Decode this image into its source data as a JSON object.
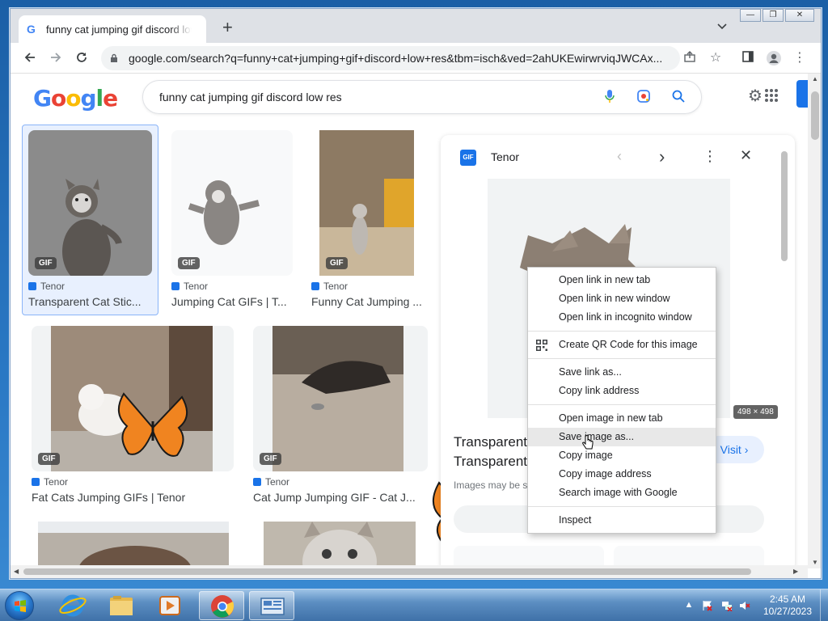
{
  "browser": {
    "tab_title": "funny cat jumping gif discord low res",
    "tab_close": "×",
    "new_tab": "+",
    "url": "google.com/search?q=funny+cat+jumping+gif+discord+low+res&tbm=isch&ved=2ahUKEwirwrviqJWCAx..."
  },
  "google": {
    "logo": [
      "G",
      "o",
      "o",
      "g",
      "l",
      "e"
    ],
    "logo_colors": [
      "#4285f4",
      "#ea4335",
      "#fbbc05",
      "#4285f4",
      "#34a853",
      "#ea4335"
    ],
    "query": "funny cat jumping gif discord low res"
  },
  "results": [
    {
      "badge": "GIF",
      "source": "Tenor",
      "title": "Transparent Cat Stic..."
    },
    {
      "badge": "GIF",
      "source": "Tenor",
      "title": "Jumping Cat GIFs | T..."
    },
    {
      "badge": "GIF",
      "source": "Tenor",
      "title": "Funny Cat Jumping ..."
    },
    {
      "badge": "GIF",
      "source": "Tenor",
      "title": "Fat Cats Jumping GIFs | Tenor"
    },
    {
      "badge": "GIF",
      "source": "Tenor",
      "title": "Cat Jump Jumping GIF - Cat J..."
    }
  ],
  "panel": {
    "favicon": "GIF",
    "site": "Tenor",
    "dimensions": "498 × 498",
    "title_line1": "Transparent",
    "title_line2": "Transparent",
    "note": "Images may be s",
    "visit": "Visit ›"
  },
  "context_menu": {
    "groups": [
      [
        "Open link in new tab",
        "Open link in new window",
        "Open link in incognito window"
      ],
      [
        "Create QR Code for this image"
      ],
      [
        "Save link as...",
        "Copy link address"
      ],
      [
        "Open image in new tab",
        "Save image as...",
        "Copy image",
        "Copy image address",
        "Search image with Google"
      ],
      [
        "Inspect"
      ]
    ],
    "highlighted": "Save image as..."
  },
  "taskbar": {
    "time": "2:45 AM",
    "date": "10/27/2023"
  }
}
